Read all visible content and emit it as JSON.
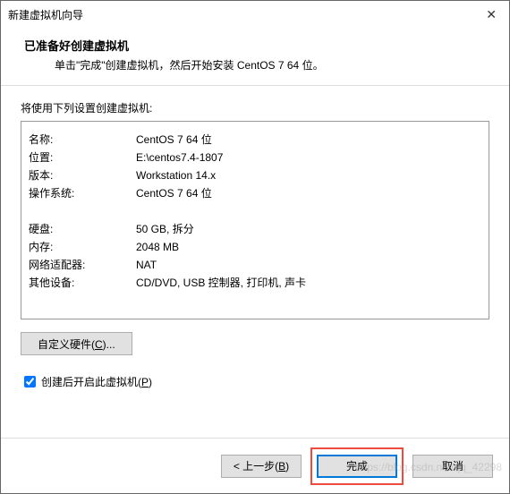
{
  "window": {
    "title": "新建虚拟机向导"
  },
  "header": {
    "title": "已准备好创建虚拟机",
    "subtitle": "单击\"完成\"创建虚拟机，然后开始安装 CentOS 7 64 位。"
  },
  "body": {
    "caption": "将使用下列设置创建虚拟机:",
    "rows": {
      "name": {
        "label": "名称:",
        "value": "CentOS 7 64 位"
      },
      "loc": {
        "label": "位置:",
        "value": "E:\\centos7.4-1807"
      },
      "ver": {
        "label": "版本:",
        "value": "Workstation 14.x"
      },
      "os": {
        "label": "操作系统:",
        "value": "CentOS 7 64 位"
      },
      "disk": {
        "label": "硬盘:",
        "value": "50 GB, 拆分"
      },
      "mem": {
        "label": "内存:",
        "value": "2048 MB"
      },
      "net": {
        "label": "网络适配器:",
        "value": "NAT"
      },
      "other": {
        "label": "其他设备:",
        "value": "CD/DVD, USB 控制器, 打印机, 声卡"
      }
    },
    "customize_prefix": "自定义硬件(",
    "customize_key": "C",
    "customize_suffix": ")...",
    "checkbox_prefix": "创建后开启此虚拟机(",
    "checkbox_key": "P",
    "checkbox_suffix": ")"
  },
  "footer": {
    "back_prefix": "< 上一步(",
    "back_key": "B",
    "back_suffix": ")",
    "finish": "完成",
    "cancel": "取消"
  },
  "watermark": "https://blog.csdn.net/qq_42298"
}
